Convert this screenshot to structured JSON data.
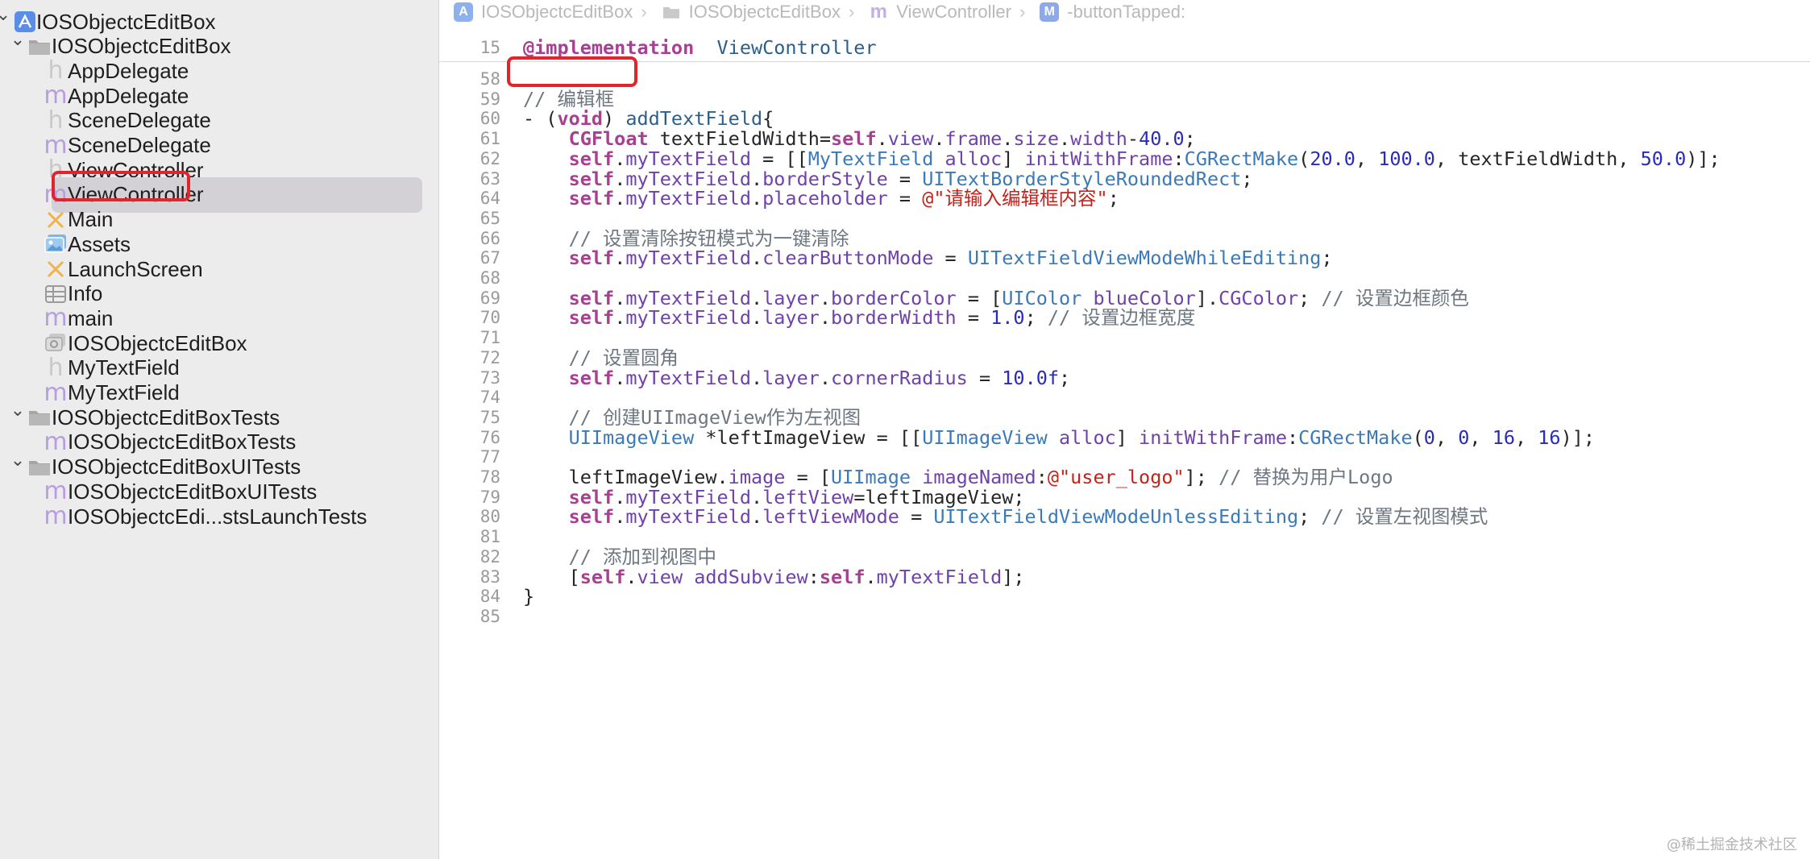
{
  "navigator": {
    "items": [
      {
        "label": "IOSObjectcEditBox",
        "icon": "project-icon",
        "disclosure": "expanded"
      },
      {
        "label": "IOSObjectcEditBox",
        "icon": "folder-icon",
        "disclosure": "expanded"
      },
      {
        "label": "AppDelegate",
        "icon": "header-file-icon",
        "glyph": "h"
      },
      {
        "label": "AppDelegate",
        "icon": "objc-file-icon",
        "glyph": "m"
      },
      {
        "label": "SceneDelegate",
        "icon": "header-file-icon",
        "glyph": "h"
      },
      {
        "label": "SceneDelegate",
        "icon": "objc-file-icon",
        "glyph": "m"
      },
      {
        "label": "ViewController",
        "icon": "header-file-icon",
        "glyph": "h"
      },
      {
        "label": "ViewController",
        "icon": "objc-file-icon",
        "glyph": "m",
        "selected": true
      },
      {
        "label": "Main",
        "icon": "storyboard-icon"
      },
      {
        "label": "Assets",
        "icon": "asset-catalog-icon"
      },
      {
        "label": "LaunchScreen",
        "icon": "storyboard-icon"
      },
      {
        "label": "Info",
        "icon": "plist-icon"
      },
      {
        "label": "main",
        "icon": "objc-file-icon",
        "glyph": "m"
      },
      {
        "label": "IOSObjectcEditBox",
        "icon": "entitlements-icon"
      },
      {
        "label": "MyTextField",
        "icon": "header-file-icon",
        "glyph": "h"
      },
      {
        "label": "MyTextField",
        "icon": "objc-file-icon",
        "glyph": "m"
      },
      {
        "label": "IOSObjectcEditBoxTests",
        "icon": "folder-icon",
        "disclosure": "expanded"
      },
      {
        "label": "IOSObjectcEditBoxTests",
        "icon": "objc-file-icon",
        "glyph": "m"
      },
      {
        "label": "IOSObjectcEditBoxUITests",
        "icon": "folder-icon",
        "disclosure": "expanded"
      },
      {
        "label": "IOSObjectcEditBoxUITests",
        "icon": "objc-file-icon",
        "glyph": "m"
      },
      {
        "label": "IOSObjectcEdi...stsLaunchTests",
        "icon": "objc-file-icon",
        "glyph": "m"
      }
    ]
  },
  "jumpbar": {
    "crumbs": [
      {
        "label": "IOSObjectcEditBox",
        "icon": "project-icon"
      },
      {
        "label": "IOSObjectcEditBox",
        "icon": "folder-icon"
      },
      {
        "label": "ViewController",
        "icon": "objc-file-icon",
        "glyph": "m"
      },
      {
        "label": "-buttonTapped:",
        "icon": "method-icon",
        "glyph": "M"
      }
    ]
  },
  "sticky_header": {
    "line": "15",
    "tokens": [
      [
        "kw",
        "@implementation"
      ],
      [
        "",
        "  "
      ],
      [
        "fn",
        "ViewController"
      ]
    ]
  },
  "code_lines": [
    {
      "n": "58",
      "tokens": []
    },
    {
      "n": "59",
      "tokens": [
        [
          "cm",
          "// 编辑框"
        ]
      ]
    },
    {
      "n": "60",
      "tokens": [
        [
          "",
          "- ("
        ],
        [
          "kw",
          "void"
        ],
        [
          "",
          ") "
        ],
        [
          "fn",
          "addTextField"
        ],
        [
          "",
          "{"
        ]
      ]
    },
    {
      "n": "61",
      "tokens": [
        [
          "",
          "    "
        ],
        [
          "kw",
          "CGFloat"
        ],
        [
          "",
          " textFieldWidth="
        ],
        [
          "kw",
          "self"
        ],
        [
          "",
          "."
        ],
        [
          "pr",
          "view"
        ],
        [
          "",
          "."
        ],
        [
          "pr",
          "frame"
        ],
        [
          "",
          "."
        ],
        [
          "pr",
          "size"
        ],
        [
          "",
          "."
        ],
        [
          "pr",
          "width"
        ],
        [
          "",
          "-"
        ],
        [
          "num",
          "40.0"
        ],
        [
          "",
          ";"
        ]
      ]
    },
    {
      "n": "62",
      "tokens": [
        [
          "",
          "    "
        ],
        [
          "kw",
          "self"
        ],
        [
          "",
          "."
        ],
        [
          "pr",
          "myTextField"
        ],
        [
          "",
          " = [["
        ],
        [
          "ty",
          "MyTextField"
        ],
        [
          "",
          " "
        ],
        [
          "pr",
          "alloc"
        ],
        [
          "",
          "] "
        ],
        [
          "pr",
          "initWithFrame"
        ],
        [
          "",
          ":"
        ],
        [
          "ty",
          "CGRectMake"
        ],
        [
          "",
          "("
        ],
        [
          "num",
          "20.0"
        ],
        [
          "",
          ", "
        ],
        [
          "num",
          "100.0"
        ],
        [
          "",
          ", textFieldWidth, "
        ],
        [
          "num",
          "50.0"
        ],
        [
          "",
          ")];"
        ]
      ]
    },
    {
      "n": "63",
      "tokens": [
        [
          "",
          "    "
        ],
        [
          "kw",
          "self"
        ],
        [
          "",
          "."
        ],
        [
          "pr",
          "myTextField"
        ],
        [
          "",
          "."
        ],
        [
          "pr",
          "borderStyle"
        ],
        [
          "",
          " = "
        ],
        [
          "ty",
          "UITextBorderStyleRoundedRect"
        ],
        [
          "",
          ";"
        ]
      ]
    },
    {
      "n": "64",
      "tokens": [
        [
          "",
          "    "
        ],
        [
          "kw",
          "self"
        ],
        [
          "",
          "."
        ],
        [
          "pr",
          "myTextField"
        ],
        [
          "",
          "."
        ],
        [
          "pr",
          "placeholder"
        ],
        [
          "",
          " = "
        ],
        [
          "str",
          "@\"请输入编辑框内容\""
        ],
        [
          "",
          ";"
        ]
      ]
    },
    {
      "n": "65",
      "tokens": []
    },
    {
      "n": "66",
      "tokens": [
        [
          "",
          "    "
        ],
        [
          "cm",
          "// 设置清除按钮模式为一键清除"
        ]
      ]
    },
    {
      "n": "67",
      "tokens": [
        [
          "",
          "    "
        ],
        [
          "kw",
          "self"
        ],
        [
          "",
          "."
        ],
        [
          "pr",
          "myTextField"
        ],
        [
          "",
          "."
        ],
        [
          "pr",
          "clearButtonMode"
        ],
        [
          "",
          " = "
        ],
        [
          "ty",
          "UITextFieldViewModeWhileEditing"
        ],
        [
          "",
          ";"
        ]
      ]
    },
    {
      "n": "68",
      "tokens": []
    },
    {
      "n": "69",
      "tokens": [
        [
          "",
          "    "
        ],
        [
          "kw",
          "self"
        ],
        [
          "",
          "."
        ],
        [
          "pr",
          "myTextField"
        ],
        [
          "",
          "."
        ],
        [
          "pr",
          "layer"
        ],
        [
          "",
          "."
        ],
        [
          "pr",
          "borderColor"
        ],
        [
          "",
          " = ["
        ],
        [
          "ty",
          "UIColor"
        ],
        [
          "",
          " "
        ],
        [
          "pr",
          "blueColor"
        ],
        [
          "",
          "]."
        ],
        [
          "pr",
          "CGColor"
        ],
        [
          "",
          "; "
        ],
        [
          "cm",
          "// 设置边框颜色"
        ]
      ]
    },
    {
      "n": "70",
      "tokens": [
        [
          "",
          "    "
        ],
        [
          "kw",
          "self"
        ],
        [
          "",
          "."
        ],
        [
          "pr",
          "myTextField"
        ],
        [
          "",
          "."
        ],
        [
          "pr",
          "layer"
        ],
        [
          "",
          "."
        ],
        [
          "pr",
          "borderWidth"
        ],
        [
          "",
          " = "
        ],
        [
          "num",
          "1.0"
        ],
        [
          "",
          "; "
        ],
        [
          "cm",
          "// 设置边框宽度"
        ]
      ]
    },
    {
      "n": "71",
      "tokens": []
    },
    {
      "n": "72",
      "tokens": [
        [
          "",
          "    "
        ],
        [
          "cm",
          "// 设置圆角"
        ]
      ]
    },
    {
      "n": "73",
      "tokens": [
        [
          "",
          "    "
        ],
        [
          "kw",
          "self"
        ],
        [
          "",
          "."
        ],
        [
          "pr",
          "myTextField"
        ],
        [
          "",
          "."
        ],
        [
          "pr",
          "layer"
        ],
        [
          "",
          "."
        ],
        [
          "pr",
          "cornerRadius"
        ],
        [
          "",
          " = "
        ],
        [
          "num",
          "10.0f"
        ],
        [
          "",
          ";"
        ]
      ]
    },
    {
      "n": "74",
      "tokens": []
    },
    {
      "n": "75",
      "tokens": [
        [
          "",
          "    "
        ],
        [
          "cm",
          "// 创建UIImageView作为左视图"
        ]
      ]
    },
    {
      "n": "76",
      "tokens": [
        [
          "",
          "    "
        ],
        [
          "ty",
          "UIImageView"
        ],
        [
          "",
          " *leftImageView = [["
        ],
        [
          "ty",
          "UIImageView"
        ],
        [
          "",
          " "
        ],
        [
          "pr",
          "alloc"
        ],
        [
          "",
          "] "
        ],
        [
          "pr",
          "initWithFrame"
        ],
        [
          "",
          ":"
        ],
        [
          "ty",
          "CGRectMake"
        ],
        [
          "",
          "("
        ],
        [
          "num",
          "0"
        ],
        [
          "",
          ", "
        ],
        [
          "num",
          "0"
        ],
        [
          "",
          ", "
        ],
        [
          "num",
          "16"
        ],
        [
          "",
          ", "
        ],
        [
          "num",
          "16"
        ],
        [
          "",
          ")];"
        ]
      ]
    },
    {
      "n": "77",
      "tokens": []
    },
    {
      "n": "78",
      "tokens": [
        [
          "",
          "    leftImageView."
        ],
        [
          "pr",
          "image"
        ],
        [
          "",
          " = ["
        ],
        [
          "ty",
          "UIImage"
        ],
        [
          "",
          " "
        ],
        [
          "pr",
          "imageNamed"
        ],
        [
          "",
          ":"
        ],
        [
          "str",
          "@\"user_logo\""
        ],
        [
          "",
          "]; "
        ],
        [
          "cm",
          "// 替换为用户Logo"
        ]
      ]
    },
    {
      "n": "79",
      "tokens": [
        [
          "",
          "    "
        ],
        [
          "kw",
          "self"
        ],
        [
          "",
          "."
        ],
        [
          "pr",
          "myTextField"
        ],
        [
          "",
          "."
        ],
        [
          "pr",
          "leftView"
        ],
        [
          "",
          "=leftImageView;"
        ]
      ]
    },
    {
      "n": "80",
      "tokens": [
        [
          "",
          "    "
        ],
        [
          "kw",
          "self"
        ],
        [
          "",
          "."
        ],
        [
          "pr",
          "myTextField"
        ],
        [
          "",
          "."
        ],
        [
          "pr",
          "leftViewMode"
        ],
        [
          "",
          " = "
        ],
        [
          "ty",
          "UITextFieldViewModeUnlessEditing"
        ],
        [
          "",
          "; "
        ],
        [
          "cm",
          "// 设置左视图模式"
        ]
      ]
    },
    {
      "n": "81",
      "tokens": []
    },
    {
      "n": "82",
      "tokens": [
        [
          "",
          "    "
        ],
        [
          "cm",
          "// 添加到视图中"
        ]
      ]
    },
    {
      "n": "83",
      "tokens": [
        [
          "",
          "    ["
        ],
        [
          "kw",
          "self"
        ],
        [
          "",
          "."
        ],
        [
          "pr",
          "view"
        ],
        [
          "",
          " "
        ],
        [
          "pr",
          "addSubview"
        ],
        [
          "",
          ":"
        ],
        [
          "kw",
          "self"
        ],
        [
          "",
          "."
        ],
        [
          "pr",
          "myTextField"
        ],
        [
          "",
          "];"
        ]
      ]
    },
    {
      "n": "84",
      "tokens": [
        [
          "",
          "}"
        ]
      ]
    },
    {
      "n": "85",
      "tokens": []
    }
  ],
  "watermark": "@稀土掘金技术社区",
  "colors": {
    "sidebar_bg": "#ececec",
    "selection_bg": "#d3d1d6",
    "highlight_box": "#e0262c",
    "keyword": "#a83f92",
    "string": "#c4231b",
    "number": "#2a2cb8"
  }
}
